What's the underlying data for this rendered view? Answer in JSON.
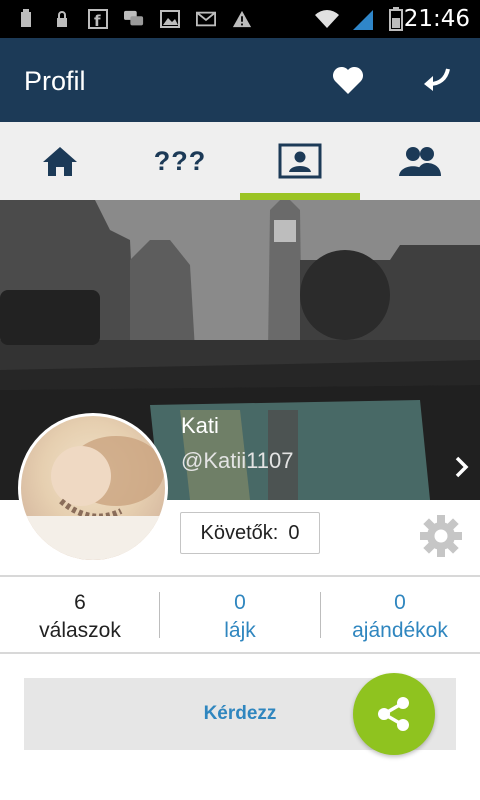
{
  "status_bar": {
    "icons": [
      "usb-icon",
      "lock-icon",
      "facebook-icon",
      "chat-icon",
      "image-icon",
      "gmail-icon",
      "warning-icon",
      "wifi-icon",
      "signal-icon",
      "battery-icon"
    ],
    "time": "21:46"
  },
  "app_bar": {
    "title": "Profil"
  },
  "tabs": [
    {
      "name": "home",
      "icon": "home-icon"
    },
    {
      "name": "questions",
      "label": "???"
    },
    {
      "name": "profile",
      "icon": "profile-card-icon",
      "active": true
    },
    {
      "name": "friends",
      "icon": "users-icon"
    }
  ],
  "profile": {
    "name": "Kati",
    "handle": "@Katii1107",
    "followers_label": "Követők:",
    "followers_count": "0"
  },
  "stats": [
    {
      "value": "6",
      "label": "válaszok",
      "color": "#222222"
    },
    {
      "value": "0",
      "label": "lájk",
      "color": "#2f86bf"
    },
    {
      "value": "0",
      "label": "ajándékok",
      "color": "#2f86bf"
    }
  ],
  "ask_button": {
    "label": "Kérdezz"
  },
  "colors": {
    "primary": "#1c3a57",
    "accent": "#9bc424",
    "link": "#2f86bf",
    "fab": "#8fc31f"
  }
}
